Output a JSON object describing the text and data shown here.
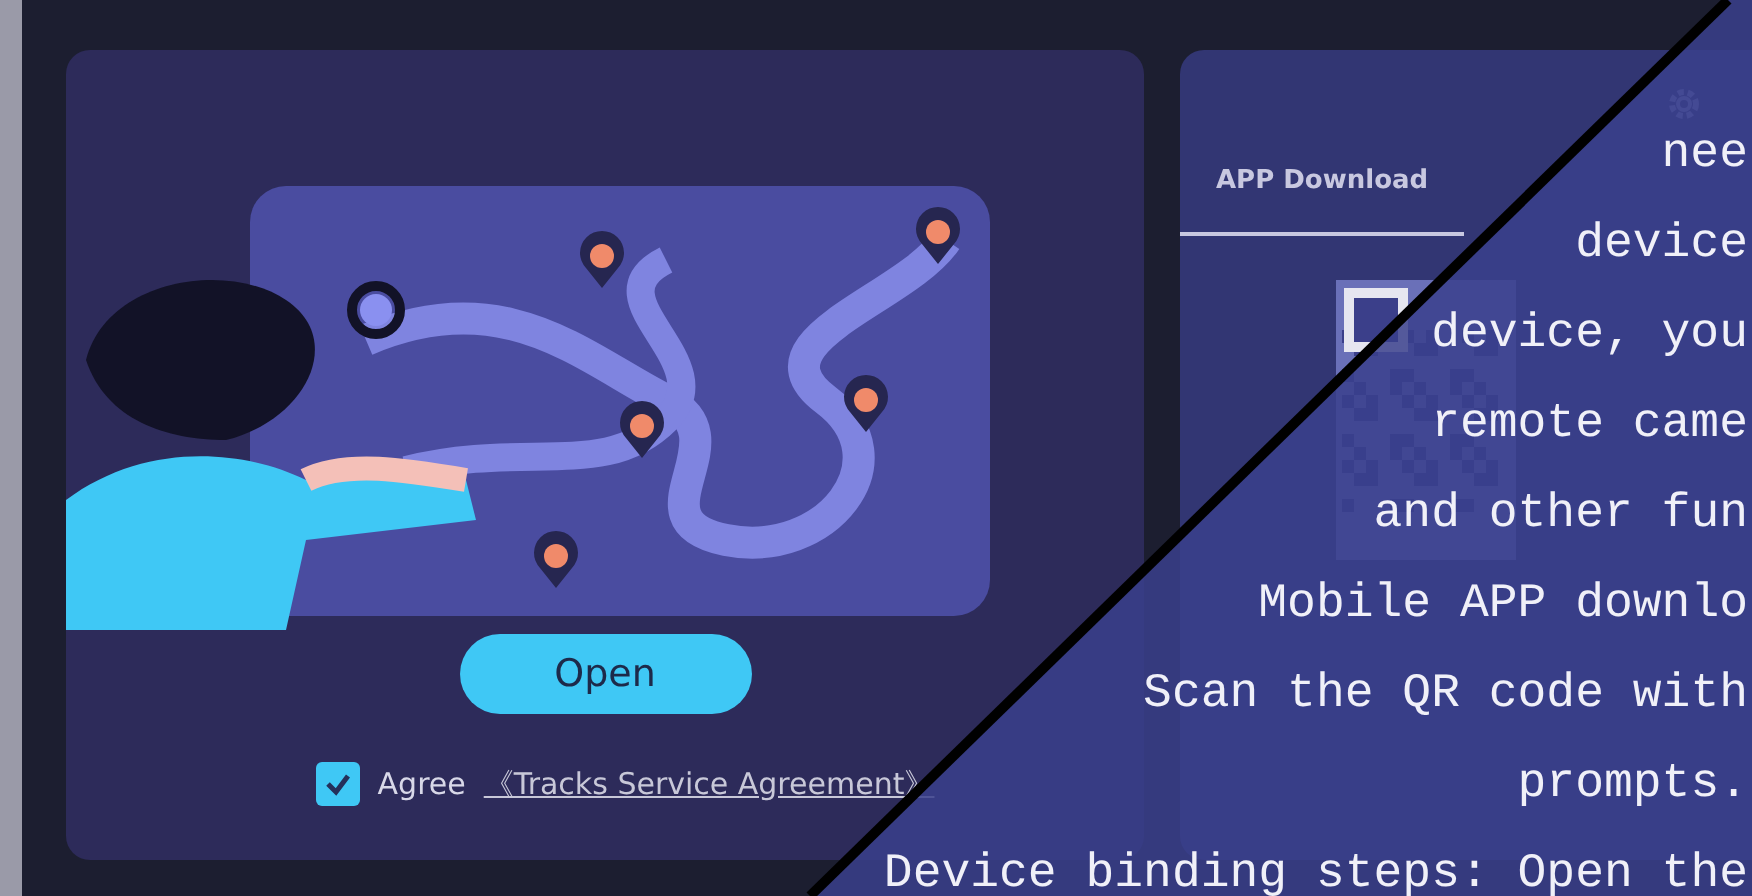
{
  "left_panel": {
    "open_button": "Open",
    "agreement": {
      "checked": true,
      "label": "Agree",
      "link": "《Tracks Service Agreement》"
    }
  },
  "right_panel": {
    "tabs": [
      {
        "label": "APP Download",
        "selected": true
      }
    ]
  },
  "overlay_text": [
    "nee",
    "device",
    "device, you",
    "remote came",
    "and other fun",
    "Mobile APP downlo",
    "Scan the QR code with",
    "prompts.",
    "Device binding steps: Open the"
  ]
}
